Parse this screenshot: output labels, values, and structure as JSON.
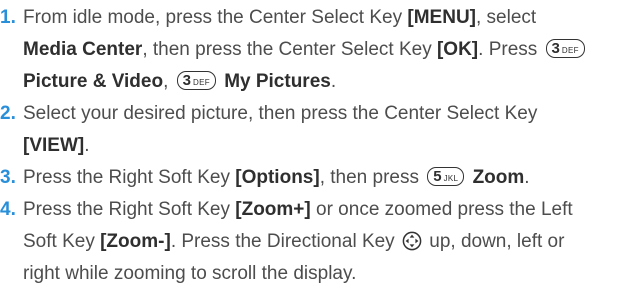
{
  "steps": [
    {
      "number": "1.",
      "line1_a": "From idle mode, press the Center Select Key ",
      "line1_menu": "[MENU]",
      "line1_b": ", select",
      "line2_media": "Media Center",
      "line2_a": ", then press the Center Select Key ",
      "line2_ok": "[OK]",
      "line2_b": ". Press ",
      "key1": {
        "digit": "3",
        "letters": "DEF"
      },
      "line3_pv": "Picture & Video",
      "line3_comma": ",",
      "key2": {
        "digit": "3",
        "letters": "DEF"
      },
      "line3_mp": "My Pictures",
      "line3_end": "."
    },
    {
      "number": "2.",
      "line1": "Select your desired picture, then press the Center Select Key",
      "line2_view": "[VIEW]",
      "line2_end": "."
    },
    {
      "number": "3.",
      "line1_a": "Press the Right Soft Key ",
      "line1_options": "[Options]",
      "line1_b": ", then press ",
      "key": {
        "digit": "5",
        "letters": "JKL"
      },
      "line1_zoom": "Zoom",
      "line1_end": "."
    },
    {
      "number": "4.",
      "line1_a": "Press the Right Soft Key ",
      "line1_zoomplus": "[Zoom+]",
      "line1_b": " or once zoomed press the Left",
      "line2_a": "Soft Key ",
      "line2_zoomminus": "[Zoom-]",
      "line2_b": ". Press the Directional Key ",
      "line2_c": " up, down, left or",
      "line3": "right while zooming to scroll the display.",
      "icon": "directional-key-icon"
    }
  ],
  "colors": {
    "number": "#2a8fd9",
    "text": "#4d4d4d",
    "bold": "#2f2f2f"
  }
}
